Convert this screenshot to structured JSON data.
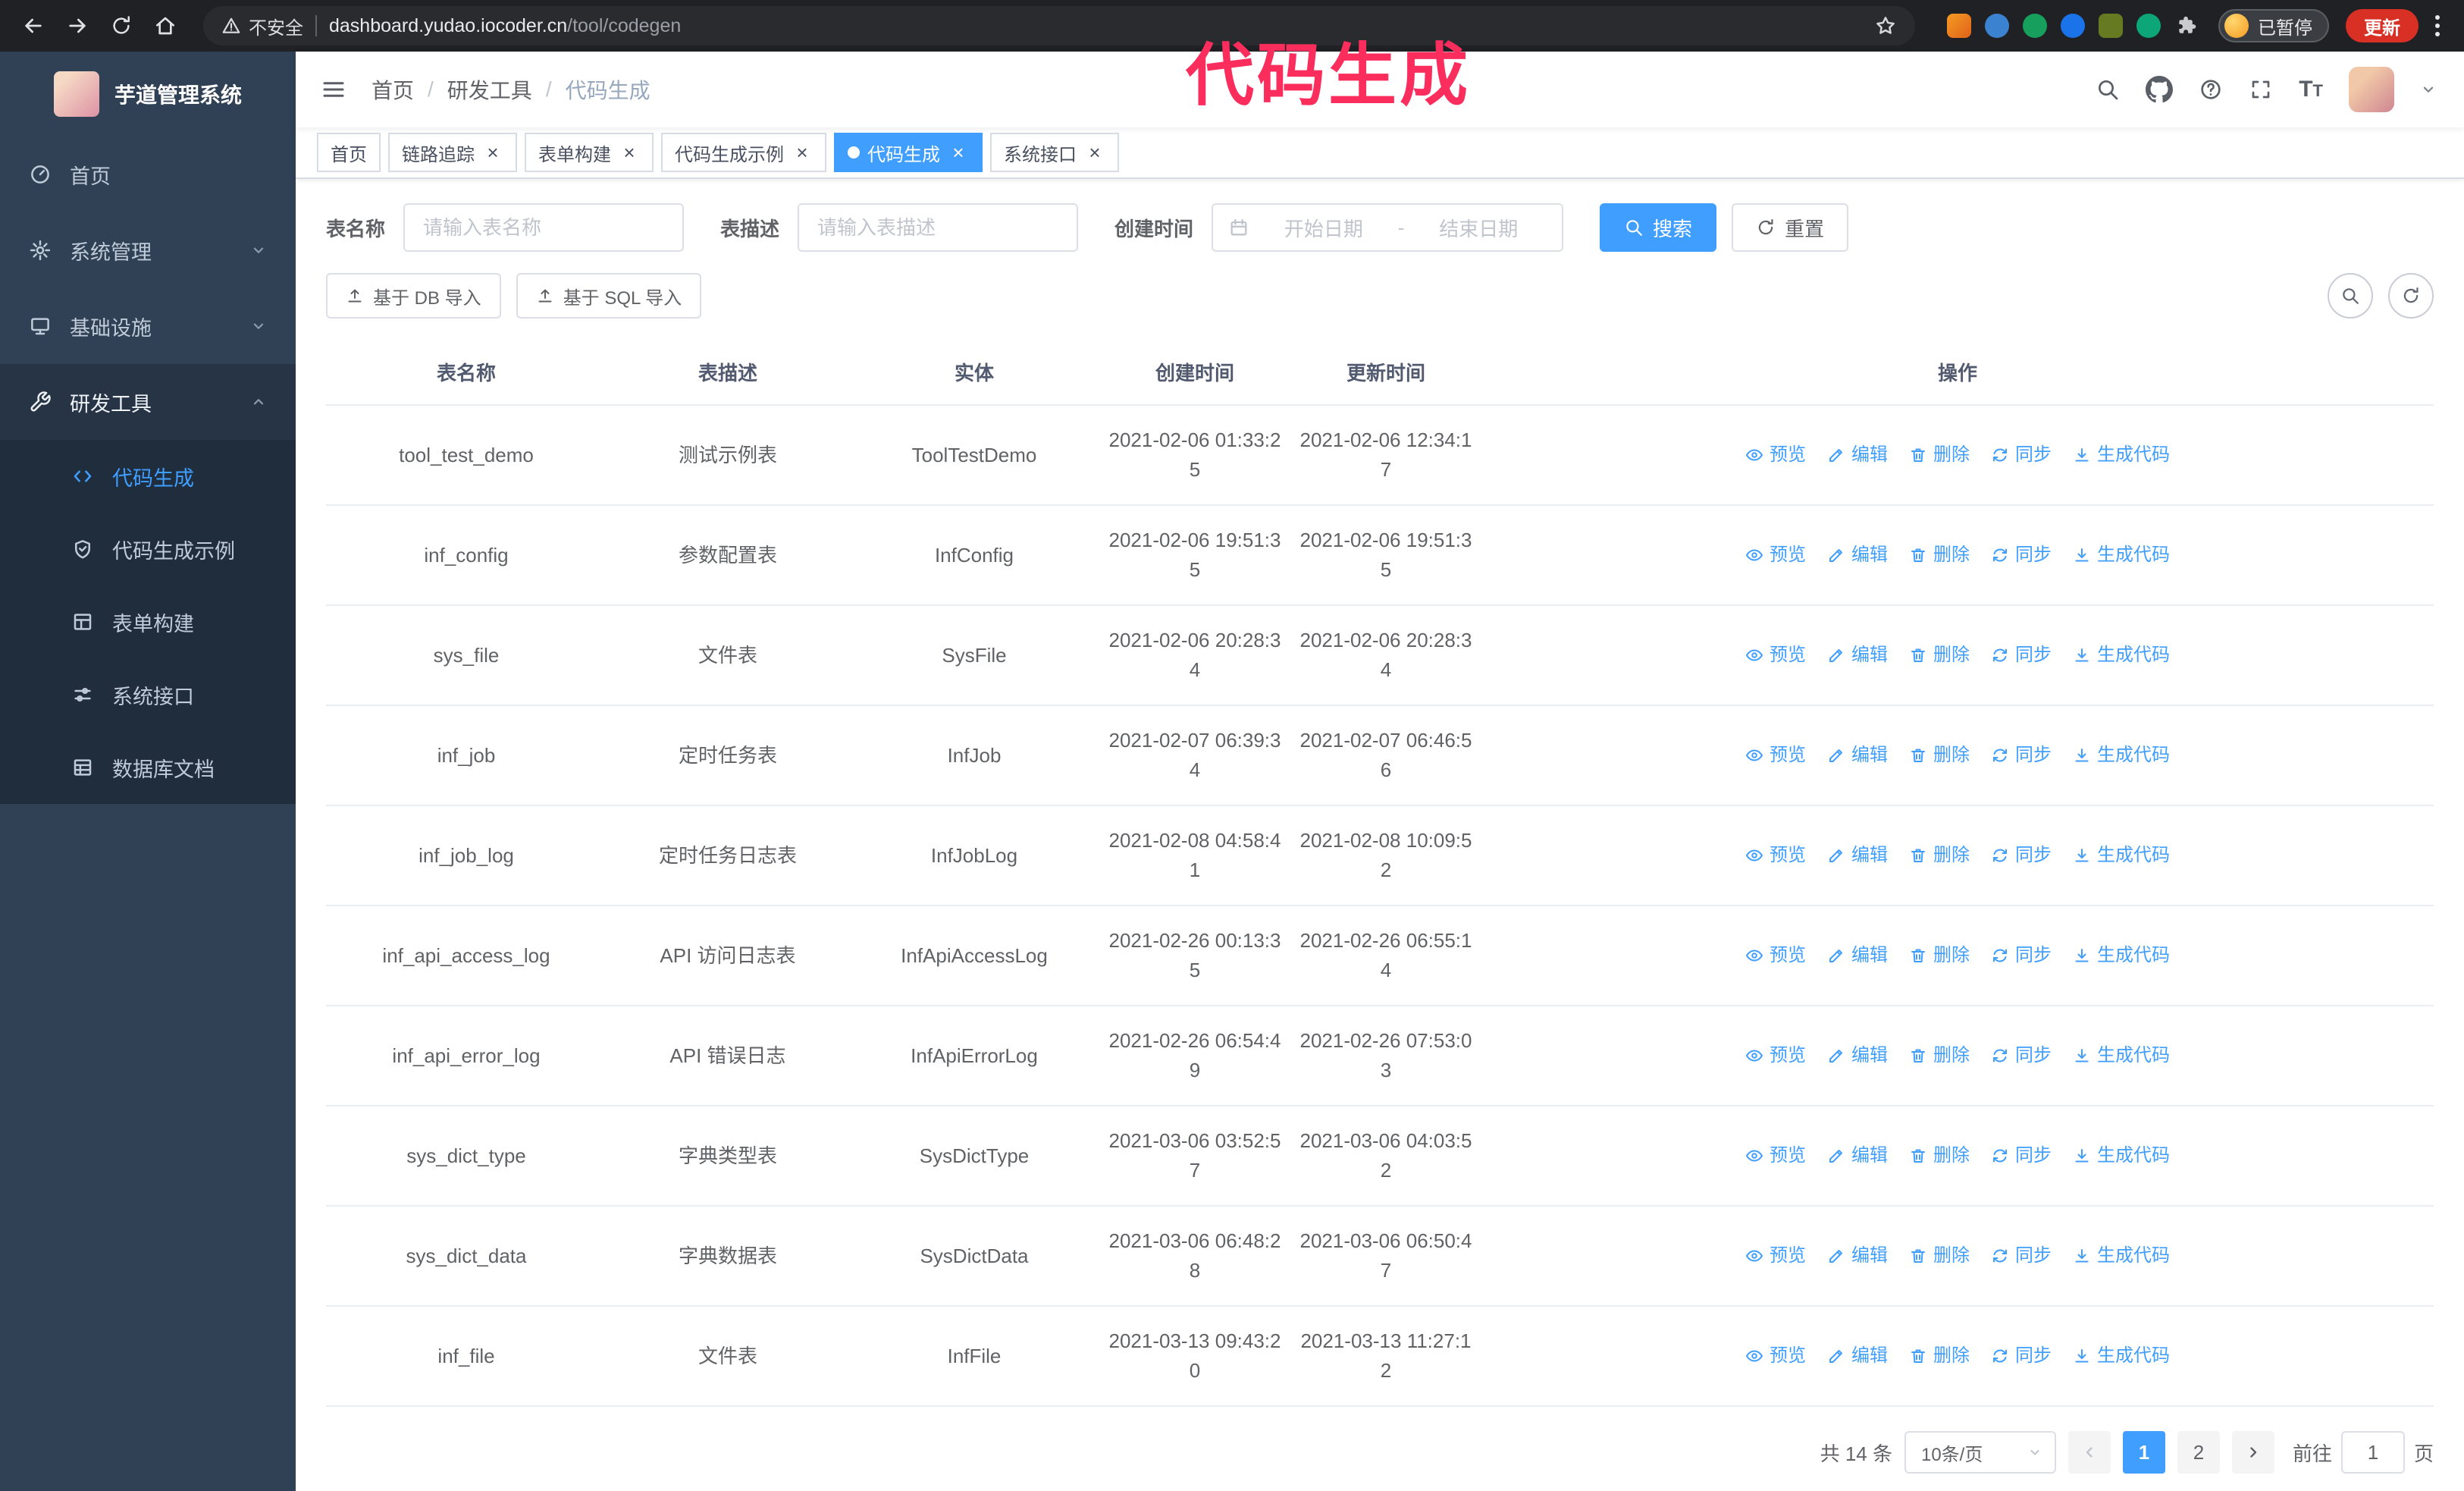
{
  "colors": {
    "accent": "#409eff",
    "annotation": "#fb2d5d",
    "sidebar_bg": "#304156"
  },
  "annotation": {
    "text": "代码生成"
  },
  "browser": {
    "security_warning": "不安全",
    "url_host": "dashboard.yudao.iocoder.cn",
    "url_path": "/tool/codegen",
    "paused_badge": "已暂停",
    "update_button": "更新"
  },
  "sidebar": {
    "logo_title": "芋道管理系统",
    "menu": [
      {
        "label": "首页"
      },
      {
        "label": "系统管理"
      },
      {
        "label": "基础设施"
      },
      {
        "label": "研发工具"
      }
    ],
    "submenu": [
      {
        "label": "代码生成",
        "active": true
      },
      {
        "label": "代码生成示例"
      },
      {
        "label": "表单构建"
      },
      {
        "label": "系统接口"
      },
      {
        "label": "数据库文档"
      }
    ]
  },
  "header": {
    "breadcrumb": [
      "首页",
      "研发工具",
      "代码生成"
    ],
    "breadcrumb_separator": "/"
  },
  "tabs": [
    {
      "label": "首页",
      "closable": false,
      "active": false
    },
    {
      "label": "链路追踪",
      "closable": true,
      "active": false
    },
    {
      "label": "表单构建",
      "closable": true,
      "active": false
    },
    {
      "label": "代码生成示例",
      "closable": true,
      "active": false
    },
    {
      "label": "代码生成",
      "closable": true,
      "active": true
    },
    {
      "label": "系统接口",
      "closable": true,
      "active": false
    }
  ],
  "filters": {
    "table_name_label": "表名称",
    "table_name_placeholder": "请输入表名称",
    "table_desc_label": "表描述",
    "table_desc_placeholder": "请输入表描述",
    "create_time_label": "创建时间",
    "start_date_placeholder": "开始日期",
    "date_separator": "-",
    "end_date_placeholder": "结束日期",
    "search_button": "搜索",
    "reset_button": "重置"
  },
  "toolbar": {
    "import_db": "基于 DB 导入",
    "import_sql": "基于 SQL 导入"
  },
  "table": {
    "columns": [
      "表名称",
      "表描述",
      "实体",
      "创建时间",
      "更新时间",
      "操作"
    ],
    "actions": [
      "预览",
      "编辑",
      "删除",
      "同步",
      "生成代码"
    ],
    "rows": [
      {
        "name": "tool_test_demo",
        "desc": "测试示例表",
        "entity": "ToolTestDemo",
        "created": "2021-02-06 01:33:25",
        "updated": "2021-02-06 12:34:17"
      },
      {
        "name": "inf_config",
        "desc": "参数配置表",
        "entity": "InfConfig",
        "created": "2021-02-06 19:51:35",
        "updated": "2021-02-06 19:51:35"
      },
      {
        "name": "sys_file",
        "desc": "文件表",
        "entity": "SysFile",
        "created": "2021-02-06 20:28:34",
        "updated": "2021-02-06 20:28:34"
      },
      {
        "name": "inf_job",
        "desc": "定时任务表",
        "entity": "InfJob",
        "created": "2021-02-07 06:39:34",
        "updated": "2021-02-07 06:46:56"
      },
      {
        "name": "inf_job_log",
        "desc": "定时任务日志表",
        "entity": "InfJobLog",
        "created": "2021-02-08 04:58:41",
        "updated": "2021-02-08 10:09:52"
      },
      {
        "name": "inf_api_access_log",
        "desc": "API 访问日志表",
        "entity": "InfApiAccessLog",
        "created": "2021-02-26 00:13:35",
        "updated": "2021-02-26 06:55:14"
      },
      {
        "name": "inf_api_error_log",
        "desc": "API 错误日志",
        "entity": "InfApiErrorLog",
        "created": "2021-02-26 06:54:49",
        "updated": "2021-02-26 07:53:03"
      },
      {
        "name": "sys_dict_type",
        "desc": "字典类型表",
        "entity": "SysDictType",
        "created": "2021-03-06 03:52:57",
        "updated": "2021-03-06 04:03:52"
      },
      {
        "name": "sys_dict_data",
        "desc": "字典数据表",
        "entity": "SysDictData",
        "created": "2021-03-06 06:48:28",
        "updated": "2021-03-06 06:50:47"
      },
      {
        "name": "inf_file",
        "desc": "文件表",
        "entity": "InfFile",
        "created": "2021-03-13 09:43:20",
        "updated": "2021-03-13 11:27:12"
      }
    ]
  },
  "pagination": {
    "total": "共 14 条",
    "page_size": "10条/页",
    "pages": [
      "1",
      "2"
    ],
    "active_page": "1",
    "goto_label": "前往",
    "goto_value": "1",
    "goto_suffix": "页"
  }
}
